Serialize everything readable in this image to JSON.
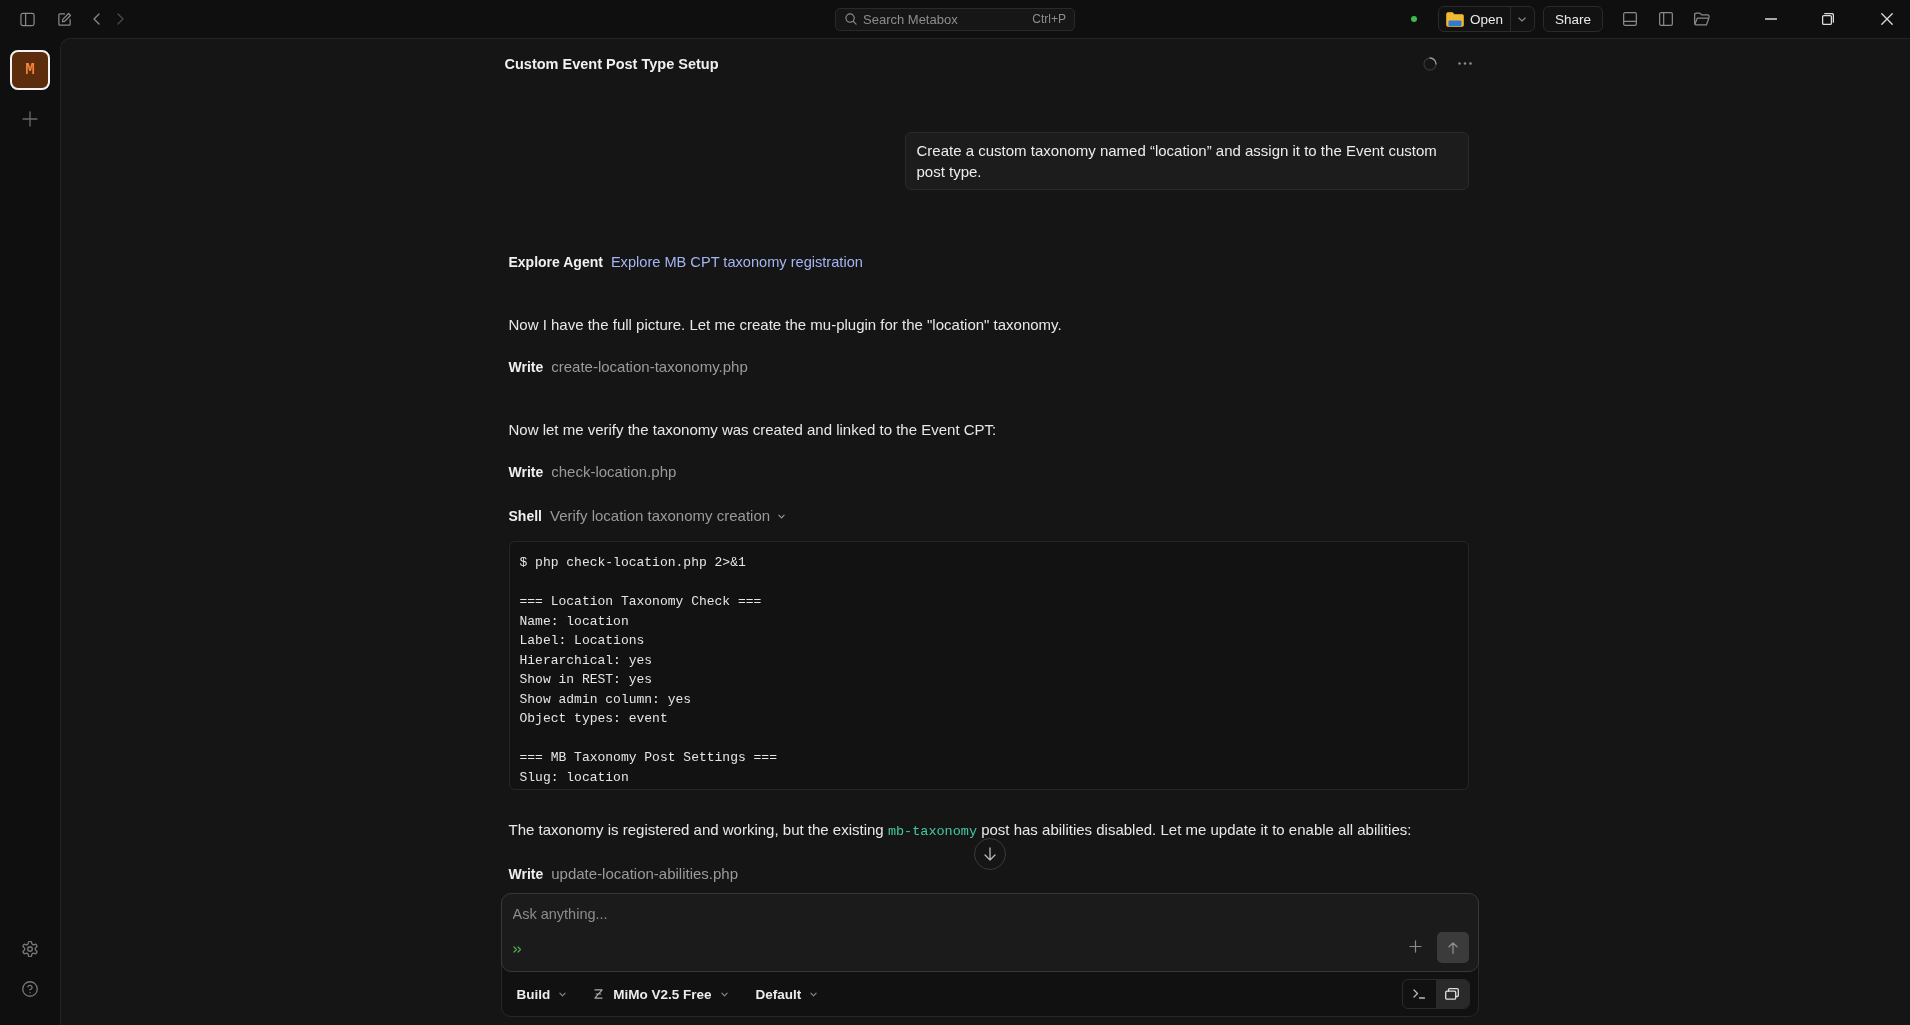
{
  "titlebar": {
    "search": {
      "placeholder": "Search Metabox",
      "shortcut": "Ctrl+P"
    },
    "open_button": {
      "label": "Open"
    },
    "share_button": {
      "label": "Share"
    }
  },
  "sidebar": {
    "workspaces": [
      {
        "initial": "M",
        "selected": true
      }
    ]
  },
  "conversation": {
    "title": "Custom Event Post Type Setup",
    "busy": true,
    "messages": [
      {
        "kind": "user",
        "text": "Create a custom taxonomy named “location” and assign it to the Event custom post type."
      },
      {
        "kind": "task",
        "tool": "Explore Agent",
        "link": "Explore MB CPT taxonomy registration"
      },
      {
        "kind": "text",
        "text": "Now I have the full picture. Let me create the mu-plugin for the \"location\" taxonomy."
      },
      {
        "kind": "tool",
        "tool": "Write",
        "target": "create-location-taxonomy.php"
      },
      {
        "kind": "text",
        "text": "Now let me verify the taxonomy was created and linked to the Event CPT:"
      },
      {
        "kind": "tool",
        "tool": "Write",
        "target": "check-location.php"
      },
      {
        "kind": "shell",
        "tool": "Shell",
        "target": "Verify location taxonomy creation",
        "expanded": true,
        "output": [
          [
            "$ php check-location.php 2>&1"
          ],
          [
            "=== Location Taxonomy Check ===",
            "Name: location",
            "Label: Locations",
            "Hierarchical: yes",
            "Show in REST: yes",
            "Show admin column: yes",
            "Object types: event"
          ],
          [
            "=== MB Taxonomy Post Settings ===",
            "Slug: location"
          ]
        ]
      },
      {
        "kind": "text",
        "parts": [
          {
            "kind": "plain",
            "text": "The taxonomy is registered and working, but the existing "
          },
          {
            "kind": "code",
            "text": "mb-taxonomy"
          },
          {
            "kind": "plain",
            "text": " post has abilities disabled. Let me update it to enable all abilities:"
          }
        ]
      },
      {
        "kind": "tool",
        "tool": "Write",
        "target": "update-location-abilities.php"
      }
    ]
  },
  "composer": {
    "placeholder": "Ask anything...",
    "dropdowns": [
      {
        "kind": "plain",
        "label": "Build"
      },
      {
        "kind": "model",
        "label": "MiMo V2.5 Free"
      },
      {
        "kind": "plain",
        "label": "Default"
      }
    ],
    "view_toggles": [
      {
        "kind": "terminal",
        "selected": false
      },
      {
        "kind": "window",
        "selected": true
      }
    ]
  }
}
